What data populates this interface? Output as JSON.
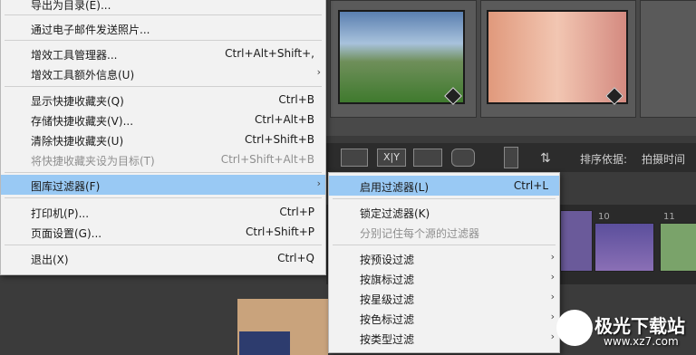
{
  "colors": {
    "accent_highlight": "#99c9f4",
    "menu_bg": "#f2f2f2",
    "app_bg": "#3b3b3b"
  },
  "toolbar": {
    "sort_label": "排序依据:",
    "sort_value": "拍摄时间",
    "xy_label": "X|Y"
  },
  "filmstrip": {
    "numbers": [
      "10",
      "11"
    ]
  },
  "main_menu": {
    "items": [
      {
        "label": "导出为目录(E)...",
        "shortcut": "",
        "arrow": ""
      },
      {
        "label": "通过电子邮件发送照片...",
        "shortcut": "",
        "arrow": ""
      },
      {
        "label": "增效工具管理器...",
        "shortcut": "Ctrl+Alt+Shift+,",
        "arrow": ""
      },
      {
        "label": "增效工具额外信息(U)",
        "shortcut": "",
        "arrow": "›"
      },
      {
        "label": "显示快捷收藏夹(Q)",
        "shortcut": "Ctrl+B",
        "arrow": ""
      },
      {
        "label": "存储快捷收藏夹(V)...",
        "shortcut": "Ctrl+Alt+B",
        "arrow": ""
      },
      {
        "label": "清除快捷收藏夹(U)",
        "shortcut": "Ctrl+Shift+B",
        "arrow": ""
      },
      {
        "label": "将快捷收藏夹设为目标(T)",
        "shortcut": "Ctrl+Shift+Alt+B",
        "arrow": ""
      },
      {
        "label": "图库过滤器(F)",
        "shortcut": "",
        "arrow": "›"
      },
      {
        "label": "打印机(P)...",
        "shortcut": "Ctrl+P",
        "arrow": ""
      },
      {
        "label": "页面设置(G)...",
        "shortcut": "Ctrl+Shift+P",
        "arrow": ""
      },
      {
        "label": "退出(X)",
        "shortcut": "Ctrl+Q",
        "arrow": ""
      }
    ]
  },
  "sub_menu": {
    "items": [
      {
        "label": "启用过滤器(L)",
        "shortcut": "Ctrl+L",
        "arrow": ""
      },
      {
        "label": "锁定过滤器(K)",
        "shortcut": "",
        "arrow": ""
      },
      {
        "label": "分别记住每个源的过滤器",
        "shortcut": "",
        "arrow": ""
      },
      {
        "label": "按预设过滤",
        "shortcut": "",
        "arrow": "›"
      },
      {
        "label": "按旗标过滤",
        "shortcut": "",
        "arrow": "›"
      },
      {
        "label": "按星级过滤",
        "shortcut": "",
        "arrow": "›"
      },
      {
        "label": "按色标过滤",
        "shortcut": "",
        "arrow": "›"
      },
      {
        "label": "按类型过滤",
        "shortcut": "",
        "arrow": "›"
      }
    ]
  },
  "watermark": {
    "title": "极光下载站",
    "url": "www.xz7.com"
  }
}
